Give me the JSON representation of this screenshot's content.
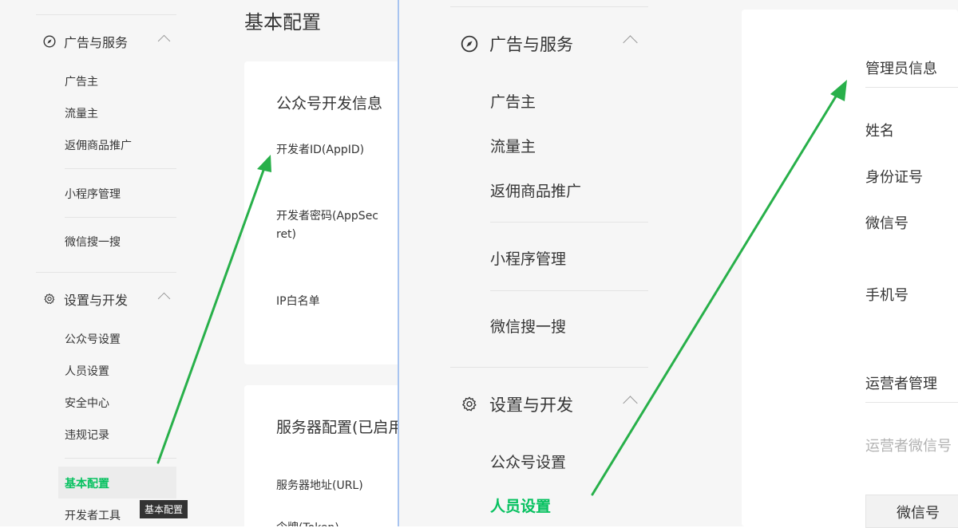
{
  "left": {
    "sidebar": {
      "ad_section": "广告与服务",
      "ad_items": [
        "广告主",
        "流量主",
        "返佣商品推广"
      ],
      "miniprogram": "小程序管理",
      "search": "微信搜一搜",
      "dev_section": "设置与开发",
      "dev_items": [
        "公众号设置",
        "人员设置",
        "安全中心",
        "违规记录"
      ],
      "active_item": "基本配置",
      "dev_tools": "开发者工具"
    },
    "page_title": "基本配置",
    "card1": {
      "title": "公众号开发信息",
      "fields": [
        "开发者ID(AppID)",
        "开发者密码(AppSec\nret)",
        "IP白名单"
      ]
    },
    "card2": {
      "title": "服务器配置(已启用",
      "fields": [
        "服务器地址(URL)",
        "令牌(Token)"
      ]
    },
    "tooltip": "基本配置"
  },
  "right": {
    "sidebar": {
      "ad_section": "广告与服务",
      "ad_items": [
        "广告主",
        "流量主",
        "返佣商品推广"
      ],
      "miniprogram": "小程序管理",
      "search": "微信搜一搜",
      "dev_section": "设置与开发",
      "dev_items": [
        "公众号设置"
      ],
      "active_item": "人员设置"
    },
    "admin": {
      "title": "管理员信息",
      "fields": [
        "姓名",
        "身份证号",
        "微信号",
        "手机号"
      ]
    },
    "operator": {
      "title": "运营者管理",
      "wechat_label": "运营者微信号",
      "table_header": "微信号"
    }
  },
  "colors": {
    "accent": "#07c160",
    "arrow": "#28b04a"
  },
  "icons": [
    "compass-icon",
    "gear-icon",
    "chevron-up-icon"
  ]
}
